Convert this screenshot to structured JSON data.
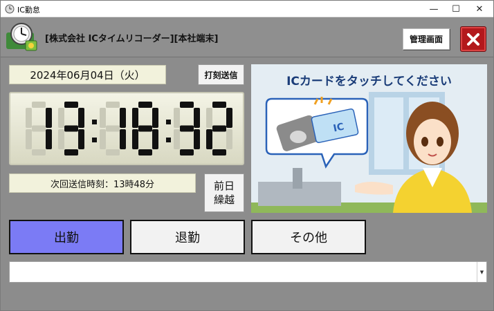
{
  "window": {
    "title": "IC勤怠"
  },
  "header": {
    "company_label": "[株式会社 ICタイムリコーダー][本社端末]",
    "admin_button": "管理画面"
  },
  "date": {
    "text": "2024年06月04日（火）"
  },
  "send_button": "打刻送信",
  "clock": {
    "time": "13:18:32",
    "hours": "13",
    "minutes": "18",
    "seconds": "32"
  },
  "next_send": {
    "text": "次回送信時刻：13時48分"
  },
  "prev_day_button": {
    "line1": "前日",
    "line2": "繰越"
  },
  "illustration": {
    "message": "ICカードをタッチしてください",
    "card_label": "IC"
  },
  "attendance": {
    "clock_in": "出勤",
    "clock_out": "退勤",
    "other": "その他",
    "selected": "出勤"
  },
  "combo": {
    "value": ""
  },
  "colors": {
    "accent_selected": "#7b7bf5",
    "exit_red": "#b3181c",
    "panel_bg": "#8c8c8c"
  }
}
